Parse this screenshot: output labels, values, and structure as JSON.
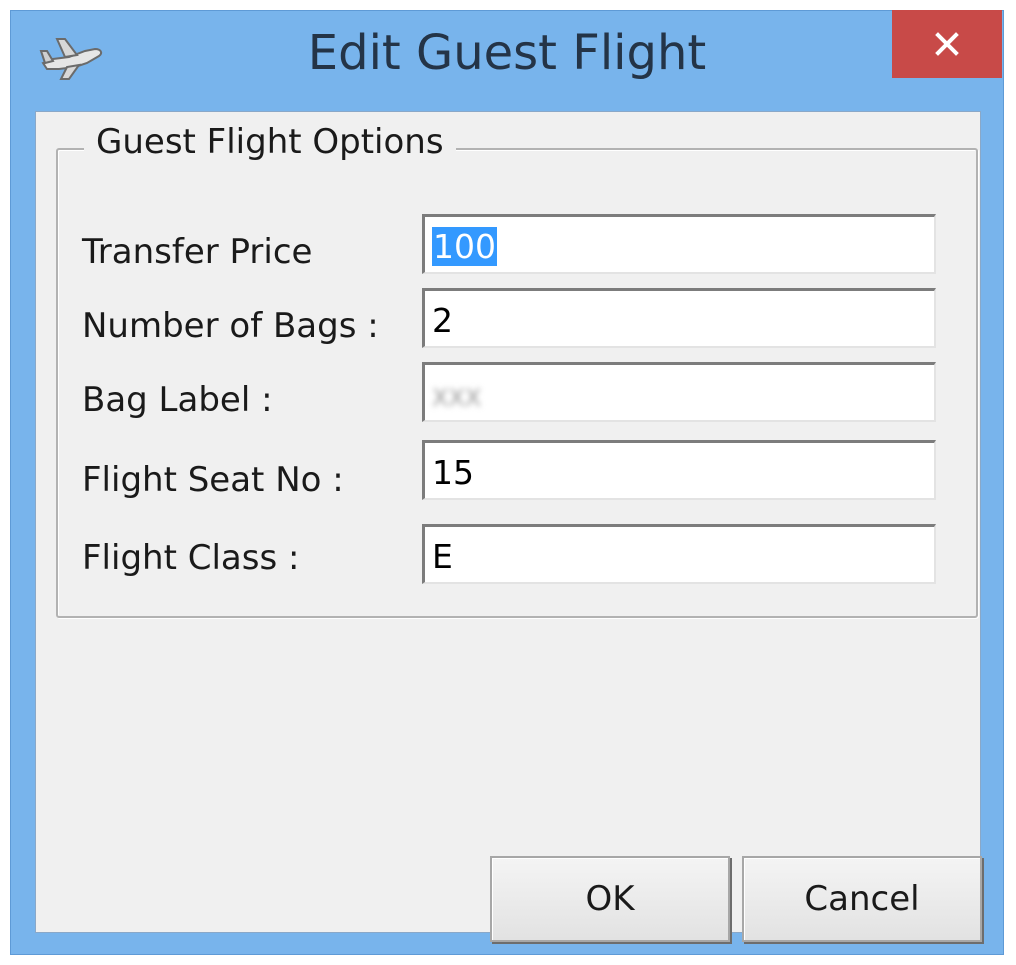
{
  "window": {
    "title": "Edit Guest Flight",
    "close_label": "×",
    "app_icon": "airplane-icon"
  },
  "group": {
    "legend": "Guest Flight Options"
  },
  "fields": [
    {
      "label": "Transfer Price",
      "value": "100",
      "selected": true
    },
    {
      "label": "Number of Bags :",
      "value": "2"
    },
    {
      "label": "Bag Label :",
      "value": "XXX",
      "redacted": true
    },
    {
      "label": "Flight Seat No :",
      "value": "15"
    },
    {
      "label": "Flight Class :",
      "value": "E"
    }
  ],
  "buttons": {
    "ok": "OK",
    "cancel": "Cancel"
  },
  "colors": {
    "titlebar": "#78b4ec",
    "close_button": "#c84a48",
    "selection": "#3399ff",
    "client_background": "#f0f0f0"
  }
}
